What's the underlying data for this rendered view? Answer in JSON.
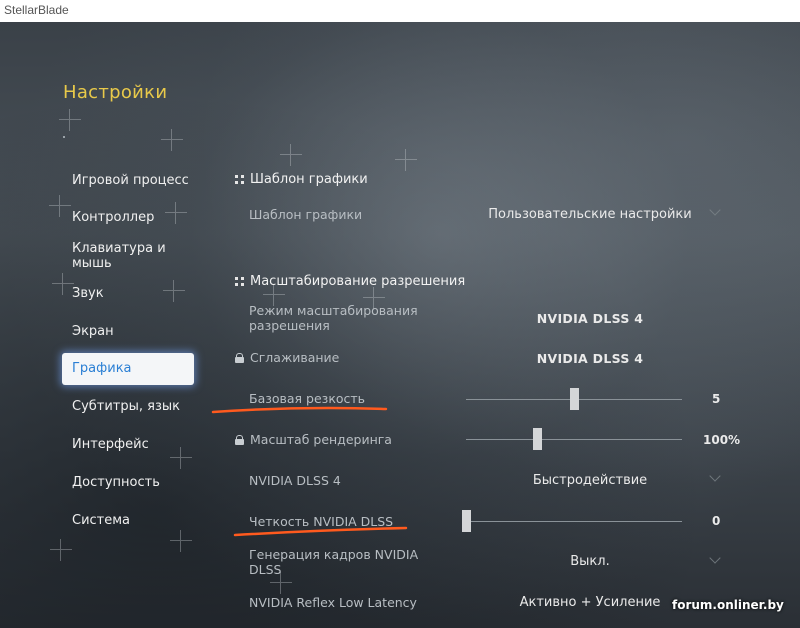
{
  "window": {
    "title": "StellarBlade"
  },
  "settings_title": "Настройки",
  "nav": {
    "items": [
      {
        "label": "Игровой процесс"
      },
      {
        "label": "Контроллер"
      },
      {
        "label": "Клавиатура и мышь"
      },
      {
        "label": "Звук"
      },
      {
        "label": "Экран"
      },
      {
        "label": "Графика",
        "active": true
      },
      {
        "label": "Субтитры, язык"
      },
      {
        "label": "Интерфейс"
      },
      {
        "label": "Доступность"
      },
      {
        "label": "Система"
      }
    ]
  },
  "sections": {
    "preset_header": "Шаблон графики",
    "scaling_header": "Масштабирование разрешения"
  },
  "rows": {
    "preset": {
      "label": "Шаблон графики",
      "value": "Пользовательские настройки"
    },
    "scaling_mode": {
      "label_line1": "Режим масштабирования",
      "label_line2": "разрешения",
      "value": "NVIDIA DLSS 4"
    },
    "antialiasing": {
      "label": "Сглаживание",
      "value": "NVIDIA DLSS 4",
      "locked": true
    },
    "sharpness": {
      "label": "Базовая резкость",
      "value": "5",
      "slider_fraction": 0.5
    },
    "render_scale": {
      "label": "Масштаб рендеринга",
      "value": "100%",
      "locked": true,
      "slider_fraction": 0.33
    },
    "dlss_mode": {
      "label": "NVIDIA DLSS 4",
      "value": "Быстродействие"
    },
    "dlss_sharpness": {
      "label": "Четкость NVIDIA DLSS",
      "value": "0",
      "slider_fraction": 0.0
    },
    "frame_gen": {
      "label_line1": "Генерация кадров NVIDIA",
      "label_line2": "DLSS",
      "value": "Выкл."
    },
    "reflex": {
      "label": "NVIDIA Reflex Low Latency",
      "value": "Активно + Усиление"
    }
  },
  "watermark": "forum.onliner.by",
  "colors": {
    "title_accent": "#e8c94a",
    "active_nav_text": "#2a7fd4",
    "annotation_underline": "#ff5a1e"
  }
}
